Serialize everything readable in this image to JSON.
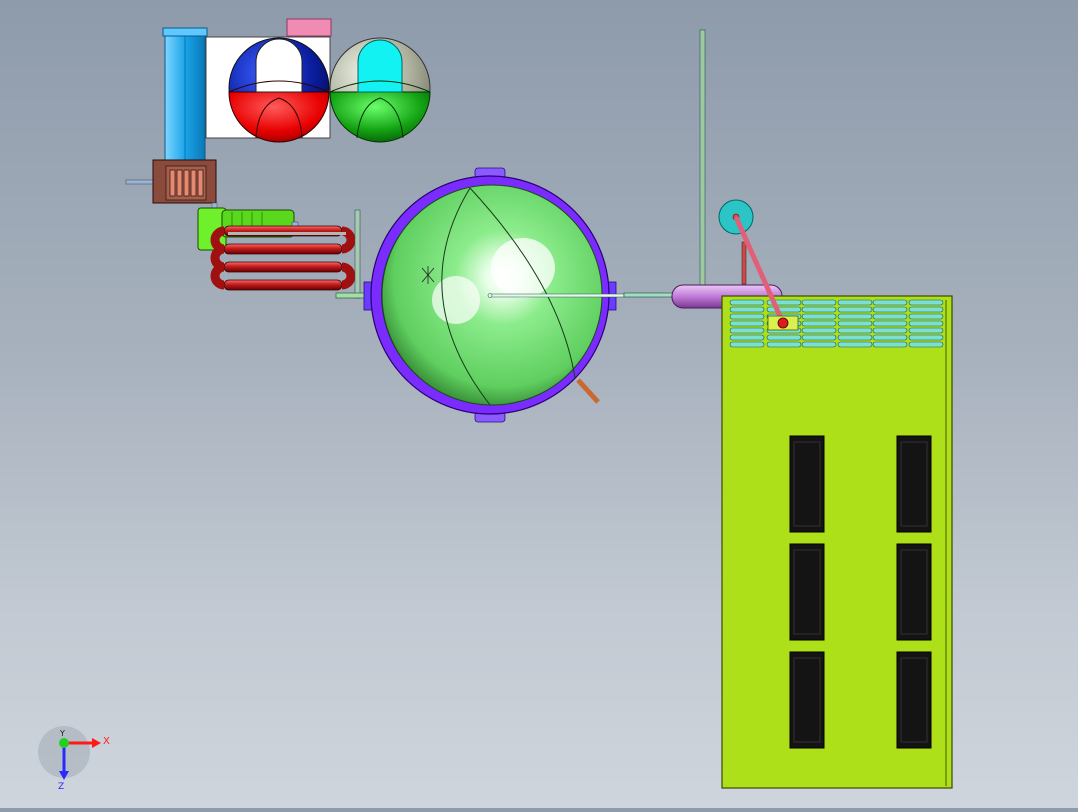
{
  "view": {
    "background_top": "#8e9bab",
    "background_bottom": "#cfd5dc"
  },
  "triad": {
    "x_label": "X",
    "y_label": "Y",
    "z_label": "Z",
    "x_color": "#ff1a1a",
    "y_color": "#22d022",
    "z_color": "#2a2aff"
  },
  "components": [
    {
      "name": "fan-unit",
      "color": "#1aa4e8"
    },
    {
      "name": "blue-red-sphere",
      "color": "#0a1ea0"
    },
    {
      "name": "green-sphere",
      "color": "#12a012"
    },
    {
      "name": "main-sphere-vessel",
      "color": "#7fe27f"
    },
    {
      "name": "vessel-ring",
      "color": "#7a2cff"
    },
    {
      "name": "coil-heat-exchanger",
      "color": "#c01c1c"
    },
    {
      "name": "motor-pump",
      "color": "#5ad81e"
    },
    {
      "name": "control-cabinet",
      "color": "#aee01a"
    },
    {
      "name": "horizontal-tank",
      "color": "#c07ad8"
    },
    {
      "name": "gauge-disc",
      "color": "#2cc4c4"
    }
  ]
}
